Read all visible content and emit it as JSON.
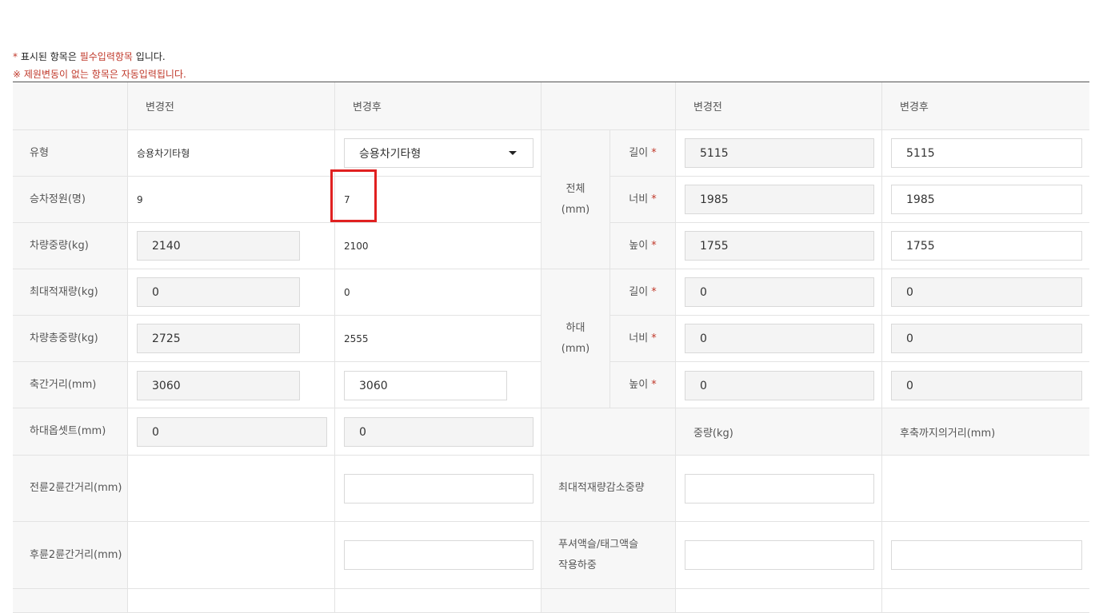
{
  "notes": {
    "line1_star": "*",
    "line1_a": "표시된 항목은",
    "line1_red": "필수입력항목",
    "line1_b": "입니다.",
    "line2": "※ 제원변동이 없는 항목은 자동입력됩니다."
  },
  "headers": {
    "before": "변경전",
    "after": "변경후",
    "before2": "변경전",
    "after2": "변경후"
  },
  "left_rows": [
    {
      "label": "유형",
      "before": "승용차기타형",
      "after": "승용차기타형"
    },
    {
      "label": "승차정원(명)",
      "before": "9",
      "after": "7"
    },
    {
      "label": "차량중량(kg)",
      "before": "2140",
      "after": "2100"
    },
    {
      "label": "최대적재량(kg)",
      "before": "0",
      "after": "0"
    },
    {
      "label": "차량총중량(kg)",
      "before": "2725",
      "after": "2555"
    },
    {
      "label": "축간거리(mm)",
      "before": "3060",
      "after": "3060"
    },
    {
      "label": "하대옵셋트(mm)",
      "before": "0",
      "after": "0"
    },
    {
      "label": "전륜2륜간거리(mm)",
      "before": "",
      "after": ""
    },
    {
      "label": "후륜2륜간거리(mm)",
      "before": "",
      "after": ""
    }
  ],
  "overall": {
    "group": "전체",
    "unit": "(mm)",
    "rows": [
      {
        "label": "길이",
        "required": "*",
        "before": "5115",
        "after": "5115"
      },
      {
        "label": "너비",
        "required": "*",
        "before": "1985",
        "after": "1985"
      },
      {
        "label": "높이",
        "required": "*",
        "before": "1755",
        "after": "1755"
      }
    ]
  },
  "bed": {
    "group": "하대",
    "unit": "(mm)",
    "rows": [
      {
        "label": "길이",
        "required": "*",
        "before": "0",
        "after": "0"
      },
      {
        "label": "너비",
        "required": "*",
        "before": "0",
        "after": "0"
      },
      {
        "label": "높이",
        "required": "*",
        "before": "0",
        "after": "0"
      }
    ]
  },
  "extra": {
    "weight_header": "중량(kg)",
    "rear_axle_header": "후축까지의거리(mm)",
    "max_load_reduction": "최대적재량감소중량",
    "pusher_tag_axle": "푸셔액슬/태그액슬",
    "pusher_tag_axle_2": "작용하중"
  },
  "highlight": {
    "color": "#e02020",
    "target": "승차정원(명) 변경후"
  }
}
